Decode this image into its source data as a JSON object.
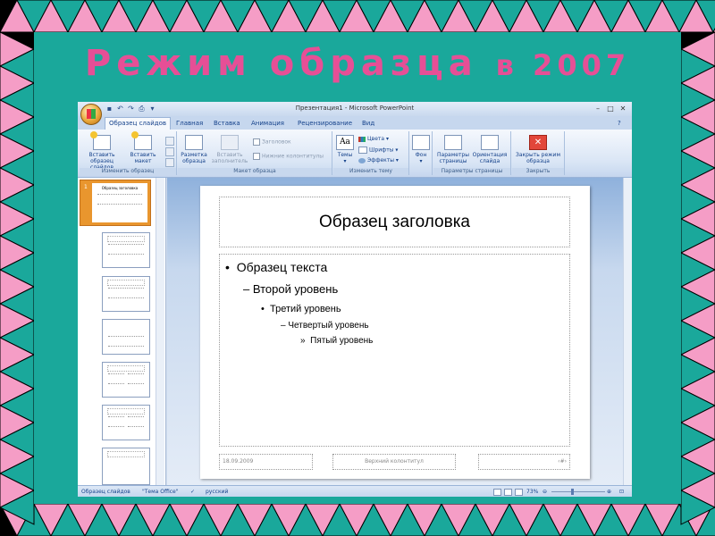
{
  "slide_title": {
    "main": "Режим образца",
    "tail": "в 2007"
  },
  "border_colors": [
    "#f59dc6",
    "#e64f96",
    "#c91f7a",
    "#1aa89b",
    "#2f7fd0",
    "#8a3fa6",
    "#000000"
  ],
  "window": {
    "title": "Презентация1 - Microsoft PowerPoint",
    "tabs": [
      "Образец слайдов",
      "Главная",
      "Вставка",
      "Анимация",
      "Рецензирование",
      "Вид"
    ],
    "active_tab": "Образец слайдов"
  },
  "ribbon": {
    "groups": {
      "edit_master": "Изменить образец",
      "master_layout": "Макет образца",
      "edit_theme": "Изменить тему",
      "bg": "",
      "page_setup": "Параметры страницы",
      "close": "Закрыть"
    },
    "insert_master": [
      "Вставить",
      "образец слайдов"
    ],
    "insert_layout": [
      "Вставить",
      "макет"
    ],
    "layout_master": [
      "Разметка",
      "образца"
    ],
    "insert_placeholder": [
      "Вставить",
      "заполнитель"
    ],
    "chk_title": "Заголовок",
    "chk_footers": "Нижние колонтитулы",
    "themes": "Темы",
    "colors": "Цвета",
    "fonts": "Шрифты",
    "effects": "Эффекты",
    "background": "Фон",
    "page_params": [
      "Параметры",
      "страницы"
    ],
    "orientation": [
      "Ориентация",
      "слайда"
    ],
    "close_master": [
      "Закрыть режим",
      "образца"
    ]
  },
  "slide": {
    "heading": "Образец заголовка",
    "levels": [
      "Образец текста",
      "Второй уровень",
      "Третий уровень",
      "Четвертый уровень",
      "Пятый уровень"
    ],
    "bullets": [
      "•",
      "–",
      "•",
      "–",
      "»"
    ],
    "footer_date": "18.09.2009",
    "footer_center": "Верхний колонтитул",
    "footer_num": "‹#›"
  },
  "thumbnail": {
    "number": "1",
    "title": "Образец заголовка"
  },
  "status": {
    "view": "Образец слайдов",
    "theme": "\"Тема Office\"",
    "lang": "русский",
    "zoom": "73%"
  }
}
